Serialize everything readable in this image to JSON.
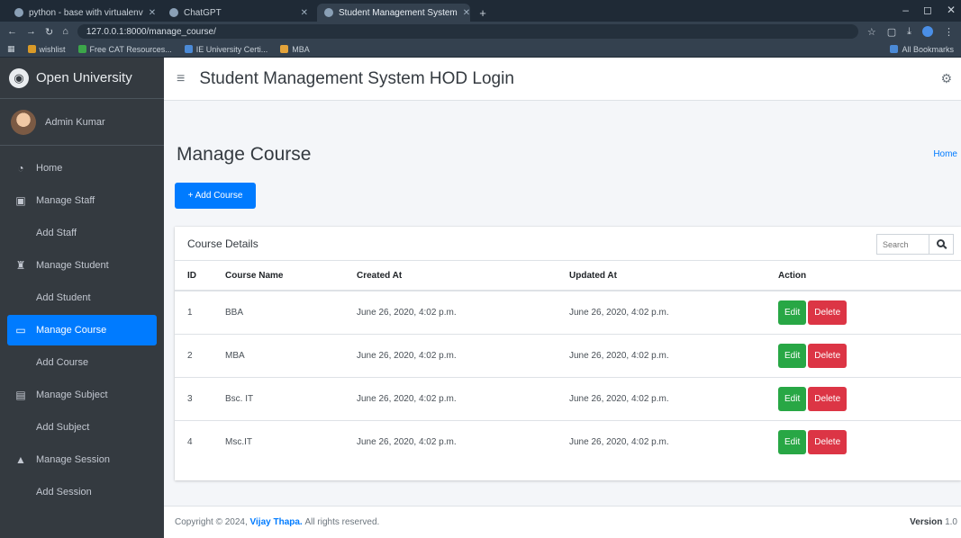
{
  "browser": {
    "tabs": [
      {
        "label": "python - base with virtualenv"
      },
      {
        "label": "ChatGPT"
      },
      {
        "label": "Student Management System"
      }
    ],
    "new_tab": "+",
    "url": "127.0.0.1:8000/manage_course/",
    "bookmarks": [
      {
        "label": "wishlist"
      },
      {
        "label": "Free CAT Resources..."
      },
      {
        "label": "IE University Certi..."
      },
      {
        "label": "MBA"
      }
    ],
    "all_bookmarks": "All Bookmarks"
  },
  "sidebar": {
    "brand": "Open University",
    "user_name": "Admin Kumar",
    "items": [
      {
        "label": "Home",
        "icon": "dashboard-icon"
      },
      {
        "label": "Manage Staff",
        "icon": "chalkboard-teacher-icon"
      },
      {
        "label": "Add Staff",
        "icon": "grid-icon"
      },
      {
        "label": "Manage Student",
        "icon": "user-graduate-icon"
      },
      {
        "label": "Add Student",
        "icon": "grid-icon"
      },
      {
        "label": "Manage Course",
        "icon": "screen-icon"
      },
      {
        "label": "Add Course",
        "icon": "grid-icon"
      },
      {
        "label": "Manage Subject",
        "icon": "book-icon"
      },
      {
        "label": "Add Subject",
        "icon": "grid-icon"
      },
      {
        "label": "Manage Session",
        "icon": "mortarboard-icon"
      },
      {
        "label": "Add Session",
        "icon": "grid-icon"
      }
    ]
  },
  "topnav": {
    "title": "Student Management System HOD Login"
  },
  "page": {
    "title": "Manage Course",
    "breadcrumb": "Home",
    "add_button": "+ Add Course"
  },
  "card": {
    "title": "Course Details",
    "search_placeholder": "Search"
  },
  "table": {
    "headers": [
      "ID",
      "Course Name",
      "Created At",
      "Updated At",
      "Action"
    ],
    "rows": [
      {
        "id": "1",
        "name": "BBA",
        "created": "June 26, 2020, 4:02 p.m.",
        "updated": "June 26, 2020, 4:02 p.m."
      },
      {
        "id": "2",
        "name": "MBA",
        "created": "June 26, 2020, 4:02 p.m.",
        "updated": "June 26, 2020, 4:02 p.m."
      },
      {
        "id": "3",
        "name": "Bsc. IT",
        "created": "June 26, 2020, 4:02 p.m.",
        "updated": "June 26, 2020, 4:02 p.m."
      },
      {
        "id": "4",
        "name": "Msc.IT",
        "created": "June 26, 2020, 4:02 p.m.",
        "updated": "June 26, 2020, 4:02 p.m."
      }
    ],
    "edit_label": "Edit",
    "delete_label": "Delete"
  },
  "footer": {
    "copyright_prefix": "Copyright © 2024,",
    "author": "Vijay Thapa.",
    "rights": "All rights reserved.",
    "version_label": "Version",
    "version_number": "1.0"
  },
  "colors": {
    "primary": "#007bff",
    "success": "#28a745",
    "danger": "#dc3545",
    "sidebar": "#343a40"
  }
}
